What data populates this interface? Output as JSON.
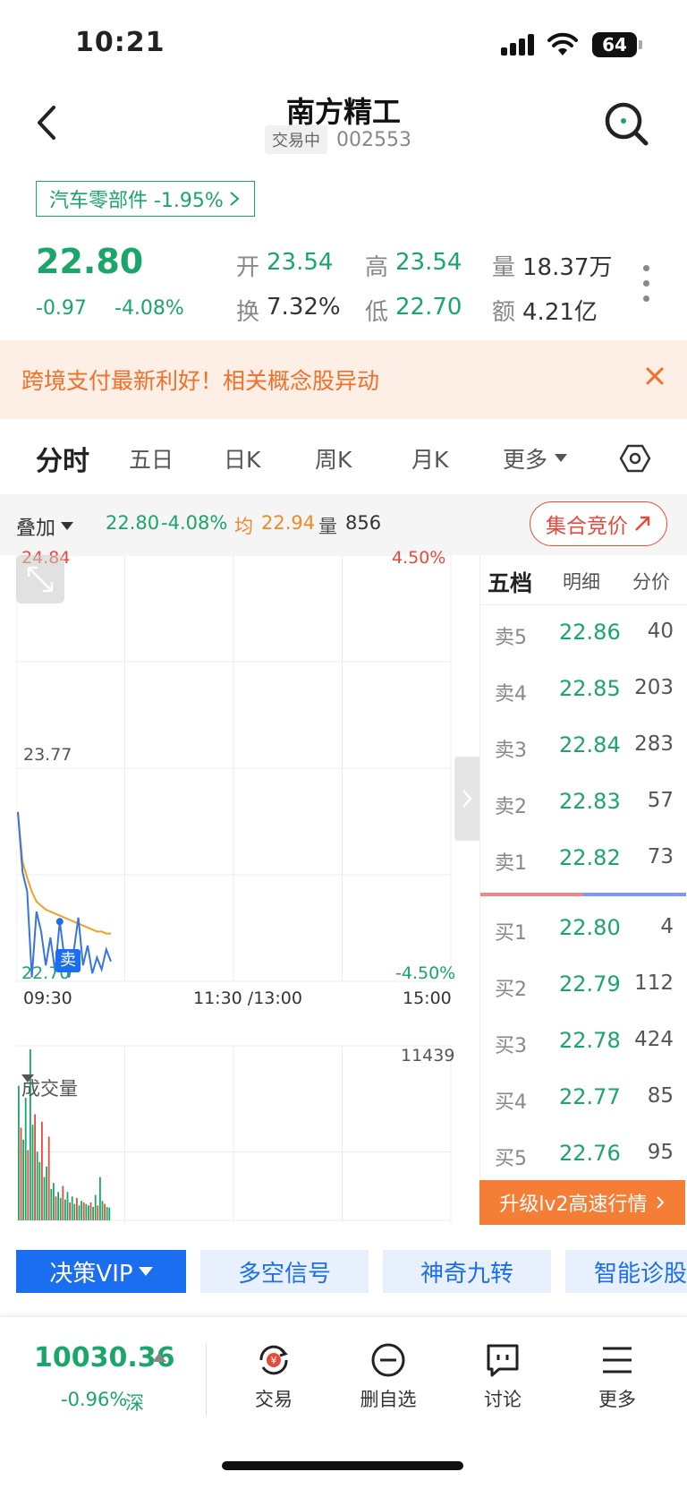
{
  "status_bar": {
    "time": "10:21",
    "battery": "64"
  },
  "header": {
    "title": "南方精工",
    "trading_status": "交易中",
    "code": "002553"
  },
  "sector_tag": {
    "text": "汽车零部件 -1.95%"
  },
  "quote": {
    "price": "22.80",
    "change": "-0.97",
    "change_pct": "-4.08%",
    "open_label": "开",
    "open": "23.54",
    "high_label": "高",
    "high": "23.54",
    "volume_label": "量",
    "volume": "18.37万",
    "turnover_label": "换",
    "turnover": "7.32%",
    "low_label": "低",
    "low": "22.70",
    "amount_label": "额",
    "amount": "4.21亿"
  },
  "banner": {
    "text": "跨境支付最新利好！相关概念股异动"
  },
  "tabs": [
    "分时",
    "五日",
    "日K",
    "周K",
    "月K",
    "更多"
  ],
  "infobar": {
    "overlay": "叠加",
    "price": "22.80",
    "pct": "-4.08%",
    "avg_label": "均",
    "avg": "22.94",
    "vol_label": "量",
    "vol": "856",
    "auction": "集合竞价"
  },
  "chart": {
    "y_top": "24.84",
    "y_mid": "23.77",
    "y_bottom": "22.70",
    "pct_top": "4.50%",
    "pct_bottom": "-4.50%",
    "x_start": "09:30",
    "x_mid": "11:30 /13:00",
    "x_end": "15:00",
    "sell_marker": "卖",
    "volume_label": "成交量",
    "volume_max": "11439"
  },
  "chart_data": {
    "type": "line",
    "ylim": [
      22.7,
      24.84
    ],
    "series": [
      {
        "values": [
          23.55,
          23.25,
          23.15,
          22.72,
          23.05,
          22.95,
          22.78,
          22.92,
          22.75,
          23.0,
          22.82,
          22.72,
          22.85,
          23.02,
          22.78,
          22.88,
          22.74,
          22.82,
          22.76,
          22.86,
          22.8
        ]
      },
      {
        "values": [
          23.55,
          23.3,
          23.22,
          23.15,
          23.1,
          23.08,
          23.06,
          23.05,
          23.04,
          23.03,
          23.02,
          23.01,
          23.0,
          22.99,
          22.98,
          22.97,
          22.96,
          22.95,
          22.95,
          22.94,
          22.94
        ]
      }
    ],
    "volume_ylim": [
      0,
      11439
    ],
    "volumes": [
      9000,
      6200,
      5400,
      8200,
      4700,
      11439,
      6400,
      7100,
      4600,
      3900,
      6600,
      2900,
      3600,
      5600,
      2100,
      2500,
      1600,
      1900,
      1500,
      2300,
      1400,
      1900,
      1200,
      1600,
      1100,
      1500,
      1000,
      1300,
      1200,
      1100,
      1000,
      1200,
      900,
      1700,
      1000,
      2900,
      1300,
      1100,
      900,
      856
    ]
  },
  "order_book": {
    "tabs": [
      "五档",
      "明细",
      "分价"
    ],
    "asks": [
      {
        "label": "卖5",
        "price": "22.86",
        "vol": "40"
      },
      {
        "label": "卖4",
        "price": "22.85",
        "vol": "203"
      },
      {
        "label": "卖3",
        "price": "22.84",
        "vol": "283"
      },
      {
        "label": "卖2",
        "price": "22.83",
        "vol": "57"
      },
      {
        "label": "卖1",
        "price": "22.82",
        "vol": "73"
      }
    ],
    "bids": [
      {
        "label": "买1",
        "price": "22.80",
        "vol": "4"
      },
      {
        "label": "买2",
        "price": "22.79",
        "vol": "112"
      },
      {
        "label": "买3",
        "price": "22.78",
        "vol": "424"
      },
      {
        "label": "买4",
        "price": "22.77",
        "vol": "85"
      },
      {
        "label": "买5",
        "price": "22.76",
        "vol": "95"
      }
    ],
    "upgrade": "升级lv2高速行情"
  },
  "tools": [
    "决策VIP",
    "多空信号",
    "神奇九转",
    "智能诊股"
  ],
  "bottom": {
    "index_value": "10030.36",
    "index_change": "-0.96%",
    "index_market": "深",
    "nav": [
      "交易",
      "删自选",
      "讨论",
      "更多"
    ]
  },
  "colors": {
    "green": "#1aa66a",
    "red": "#e84a3a",
    "orange": "#f47e36",
    "blue": "#1c6ef0"
  }
}
